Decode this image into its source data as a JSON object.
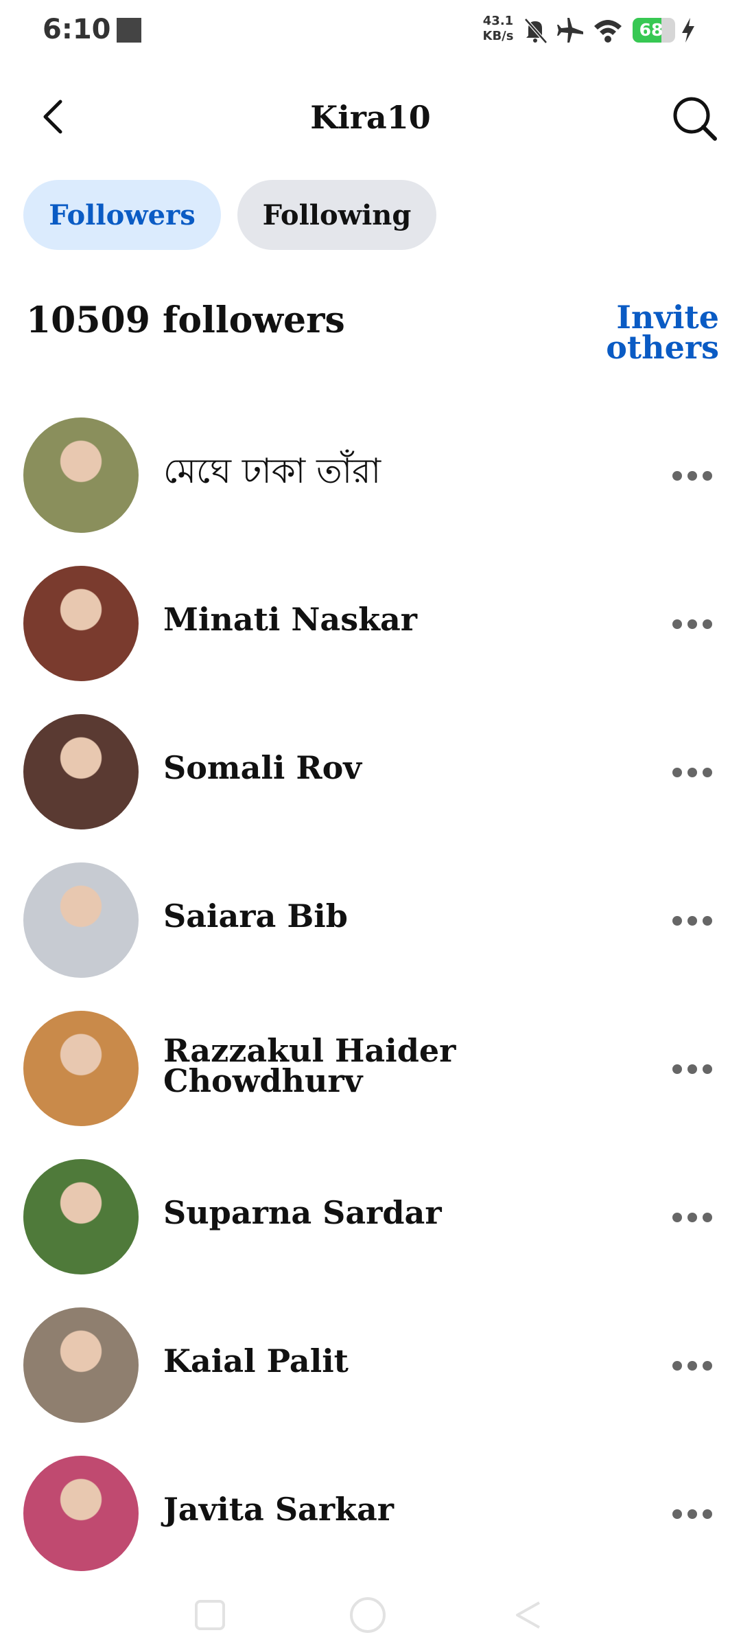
{
  "status_bar": {
    "time": "6:10",
    "net_speed_value": "43.1",
    "net_speed_unit": "KB/s",
    "battery_level": "68",
    "icons": [
      "screen-record-icon",
      "bell-off-icon",
      "airplane-icon",
      "wifi-icon",
      "battery-icon",
      "charging-bolt-icon"
    ]
  },
  "header": {
    "title": "Kira10"
  },
  "tabs": {
    "followers": "Followers",
    "following": "Following"
  },
  "summary": {
    "count_text": "10509 followers",
    "invite_line1": "Invite",
    "invite_line2": "others"
  },
  "followers": [
    {
      "name": "মেঘে ঢাকা তাঁরা",
      "avatar_color": "#8a8f5c"
    },
    {
      "name": "Minati Naskar",
      "avatar_color": "#7a3b2e"
    },
    {
      "name": "Somali Rov",
      "avatar_color": "#5a3a32"
    },
    {
      "name": "Saiara Bib",
      "avatar_color": "#c7cbd2"
    },
    {
      "name": "Razzakul Haider Chowdhurv",
      "avatar_color": "#c98a4a"
    },
    {
      "name": "Suparna Sardar",
      "avatar_color": "#4f7a3a"
    },
    {
      "name": "Kaial Palit",
      "avatar_color": "#8f7f6f"
    },
    {
      "name": "Javita Sarkar",
      "avatar_color": "#c04a70"
    }
  ],
  "colors": {
    "accent": "#0a5bc4",
    "active_tab_bg": "#dbebfd",
    "inactive_tab_bg": "#e4e6eb",
    "battery": "#37c853"
  }
}
